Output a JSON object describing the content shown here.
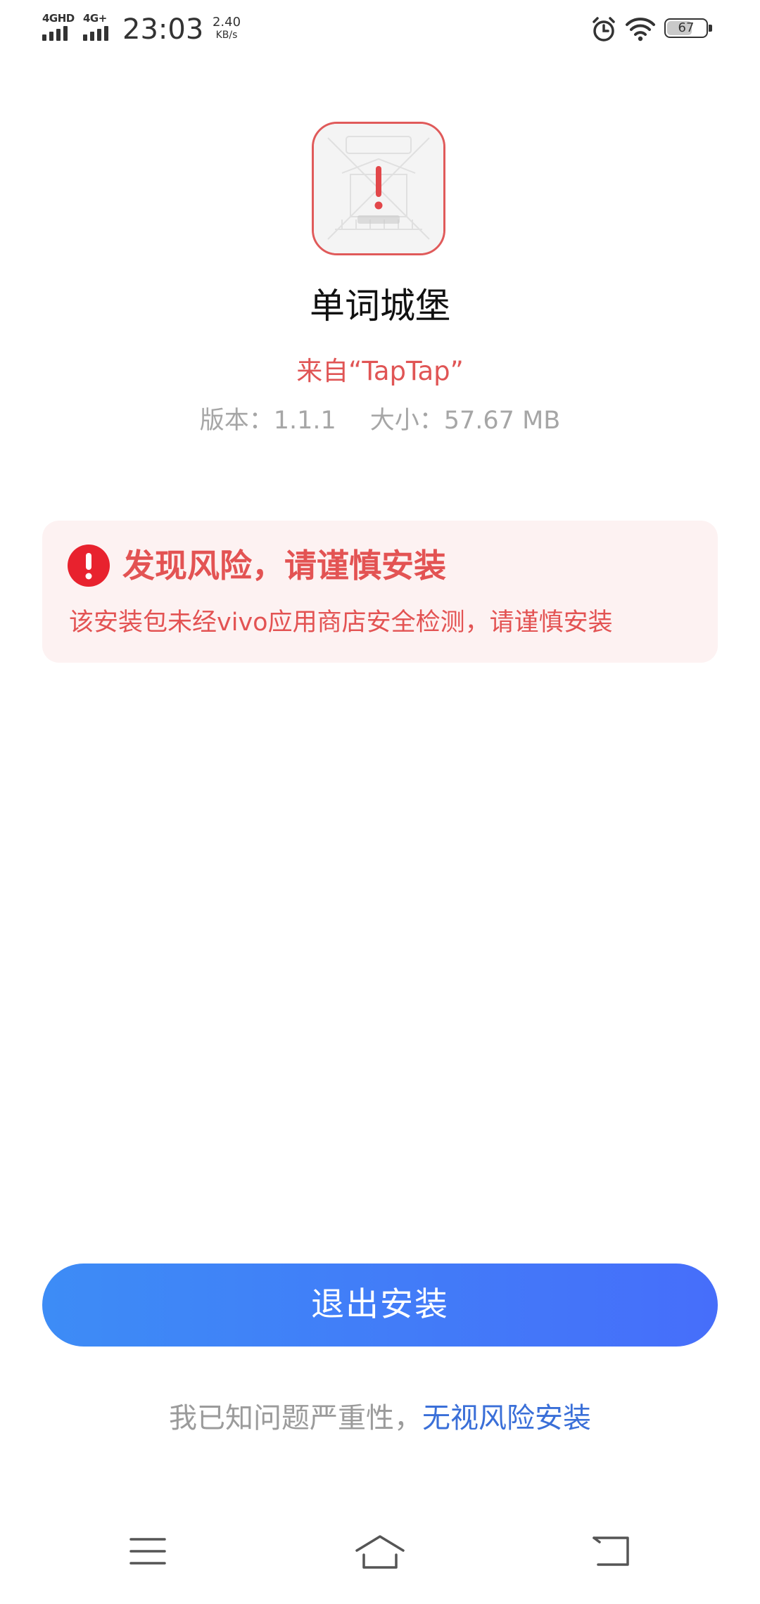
{
  "status_bar": {
    "signal1_label": "4GHD",
    "signal2_label": "4G+",
    "time": "23:03",
    "net_speed_value": "2.40",
    "net_speed_unit": "KB/s",
    "battery_level": "67",
    "icons": [
      "signal-icon",
      "alarm-icon",
      "wifi-icon",
      "battery-icon"
    ]
  },
  "app": {
    "icon": "app-icon-word-castle",
    "name": "单词城堡",
    "source": "来自“TapTap”",
    "version": "版本：1.1.1",
    "size": "大小：57.67 MB"
  },
  "warning": {
    "icon": "warning-icon",
    "title": "发现风险，请谨慎安装",
    "description": "该安装包未经vivo应用商店安全检测，请谨慎安装"
  },
  "actions": {
    "exit_label": "退出安装",
    "ignore_prefix": "我已知问题严重性，",
    "ignore_link": "无视风险安装"
  },
  "nav_bar": {
    "icons": [
      "menu-icon",
      "home-icon",
      "back-icon"
    ]
  },
  "colors": {
    "danger": "#e35353",
    "warning_bg": "#fdf2f2",
    "button_start": "#3d8cf6",
    "button_end": "#466efa",
    "link": "#3a6fd8",
    "muted": "#a6a6a6"
  }
}
